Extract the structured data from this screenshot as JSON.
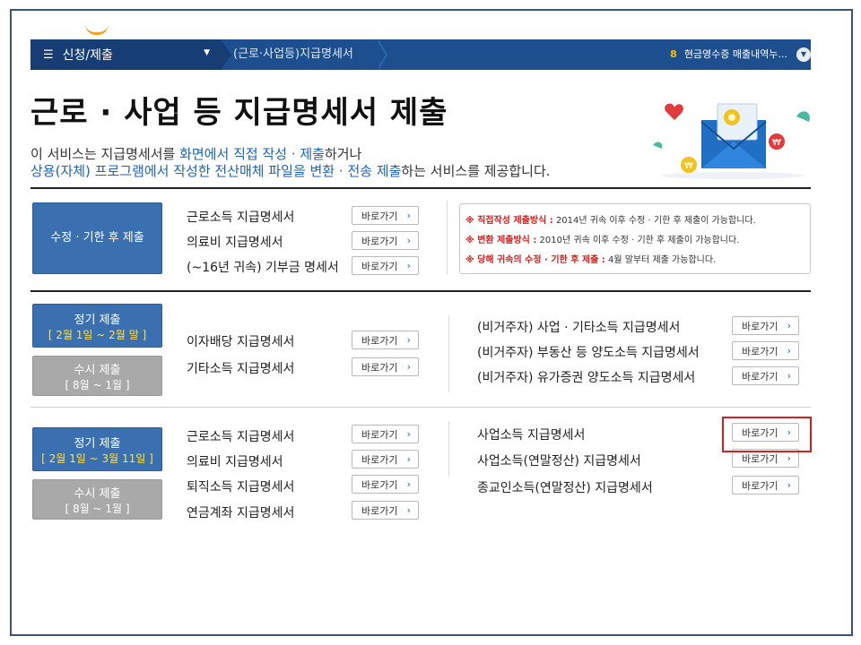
{
  "nav": {
    "menu_label": "신청/제출",
    "breadcrumb": "(근로·사업등)지급명세서",
    "right_num": "8",
    "right_text": "현금영수증 매출내역누..."
  },
  "page": {
    "title": "근로 · 사업 등 지급명세서 제출",
    "desc1_a": "이 서비스는 지급명세서를 ",
    "desc1_b": "화면에서 직접 작성 · 제출",
    "desc1_c": "하거나",
    "desc2_a": "상용(자체) 프로그램에서 작성한 전산매체 파일을 변환 · 전송 제출",
    "desc2_b": "하는 서비스를 제공합니다."
  },
  "button_label": "바로가기",
  "section1": {
    "box_label": "수정 · 기한 후 제출",
    "items": [
      "근로소득 지급명세서",
      "의료비 지급명세서",
      "(~16년 귀속) 기부금 명세서"
    ],
    "notices": [
      {
        "label": "※ 직접작성 제출방식 :",
        "text": " 2014년 귀속 이후 수정 · 기한 후 제출이 가능합니다."
      },
      {
        "label": "※ 변환 제출방식 :",
        "text": " 2010년 귀속 이후 수정 · 기한 후 제출이 가능합니다."
      },
      {
        "label": "※ 당해 귀속의 수정 · 기한 후 제출 :",
        "text": " 4월 말부터 제출 가능합니다."
      }
    ]
  },
  "section2": {
    "regular_label": "정기 제출",
    "regular_period": "[ 2월 1일 ~ 2월 말 ]",
    "adhoc_label": "수시 제출",
    "adhoc_period": "[ 8월 ~ 1월 ]",
    "left_items": [
      "이자배당 지급명세서",
      "기타소득 지급명세서"
    ],
    "right_items": [
      "(비거주자) 사업 · 기타소득 지급명세서",
      "(비거주자) 부동산 등 양도소득 지급명세서",
      "(비거주자) 유가증권 양도소득 지급명세서"
    ]
  },
  "section3": {
    "regular_label": "정기 제출",
    "regular_period": "[ 2월 1일 ~ 3월 11일 ]",
    "adhoc_label": "수시 제출",
    "adhoc_period": "[ 8월 ~ 1월 ]",
    "left_items": [
      "근로소득 지급명세서",
      "의료비 지급명세서",
      "퇴직소득 지급명세서",
      "연금계좌 지급명세서"
    ],
    "right_items": [
      "사업소득 지급명세서",
      "사업소득(연말정산) 지급명세서",
      "종교인소득(연말정산) 지급명세서"
    ]
  }
}
